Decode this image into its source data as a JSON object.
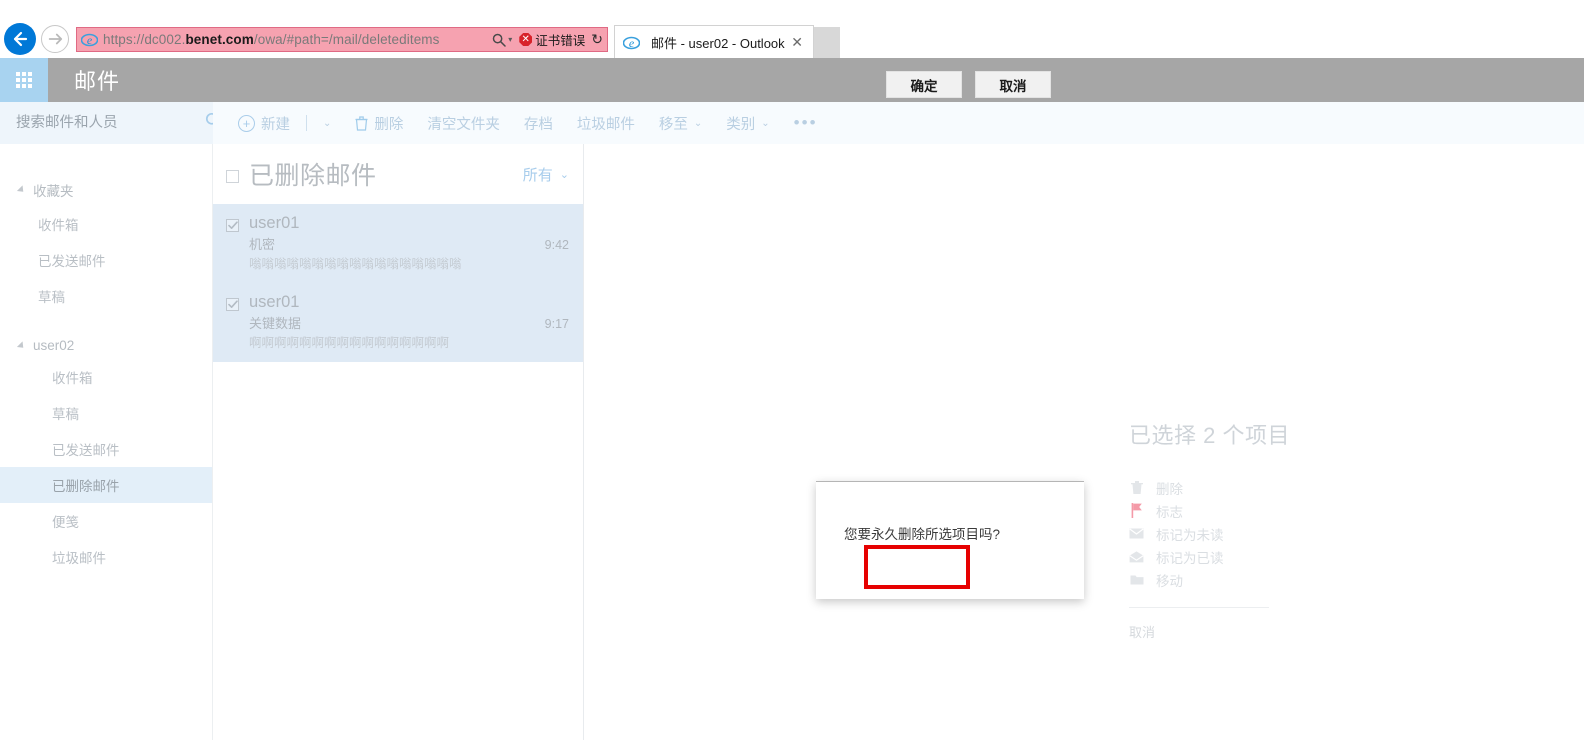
{
  "browser": {
    "back_label": "后退",
    "forward_label": "前进",
    "url_prefix": "https://dc002.",
    "url_domain": "benet.com",
    "url_suffix": "/owa/#path=/mail/deleteditems",
    "full_url": "https://dc002.benet.com/owa/#path=/mail/deleteditems",
    "search_caret": "▾",
    "cert_warning": "证书错误",
    "cert_mark": "✕",
    "refresh_glyph": "↻",
    "tab_title": "邮件 - user02 - Outlook",
    "tab_close": "✕"
  },
  "header": {
    "app_launcher": "应用启动器",
    "title": "邮件"
  },
  "search": {
    "placeholder": "搜索邮件和人员",
    "value": ""
  },
  "toolbar": {
    "new_label": "新建",
    "new_caret": "⌄",
    "delete_label": "删除",
    "empty_folder_label": "清空文件夹",
    "archive_label": "存档",
    "junk_label": "垃圾邮件",
    "move_label": "移至",
    "move_caret": "⌄",
    "category_label": "类别",
    "category_caret": "⌄",
    "more_label": "•••"
  },
  "sidebar": {
    "favorites": {
      "label": "收藏夹",
      "items": [
        {
          "label": "收件箱"
        },
        {
          "label": "已发送邮件"
        },
        {
          "label": "草稿"
        }
      ]
    },
    "account": {
      "label": "user02",
      "items": [
        {
          "label": "收件箱",
          "selected": false
        },
        {
          "label": "草稿",
          "selected": false
        },
        {
          "label": "已发送邮件",
          "selected": false
        },
        {
          "label": "已删除邮件",
          "selected": true
        },
        {
          "label": "便笺",
          "selected": false
        },
        {
          "label": "垃圾邮件",
          "selected": false
        }
      ]
    }
  },
  "list": {
    "title": "已删除邮件",
    "filter_label": "所有",
    "filter_caret": "⌄",
    "messages": [
      {
        "from": "user01",
        "subject": "机密",
        "time": "9:42",
        "preview": "嗡嗡嗡嗡嗡嗡嗡嗡嗡嗡嗡嗡嗡嗡嗡嗡嗡",
        "checked": true
      },
      {
        "from": "user01",
        "subject": "关键数据",
        "time": "9:17",
        "preview": "啊啊啊啊啊啊啊啊啊啊啊啊啊啊啊啊",
        "checked": true
      }
    ]
  },
  "selection": {
    "title": "已选择 2 个项目",
    "actions": [
      {
        "icon": "trash-icon",
        "label": "删除"
      },
      {
        "icon": "flag-icon",
        "label": "标志"
      },
      {
        "icon": "envelope-closed-icon",
        "label": "标记为未读"
      },
      {
        "icon": "envelope-open-icon",
        "label": "标记为已读"
      },
      {
        "icon": "folder-icon",
        "label": "移动"
      }
    ],
    "cancel_label": "取消"
  },
  "dialog": {
    "message": "您要永久删除所选项目吗?",
    "ok_label": "确定",
    "cancel_label": "取消"
  },
  "colors": {
    "accent_blue": "#0078d7",
    "header_gray": "#a6a6a6",
    "launcher_blue": "#a8d3f0",
    "selection_blue": "#dfeaf5",
    "sidebar_selected": "#e3eff9",
    "highlight_red": "#e60000",
    "addressbar_pink": "#f6a2b0",
    "cert_red": "#d8232a",
    "flag_pink": "#f49aa8"
  }
}
